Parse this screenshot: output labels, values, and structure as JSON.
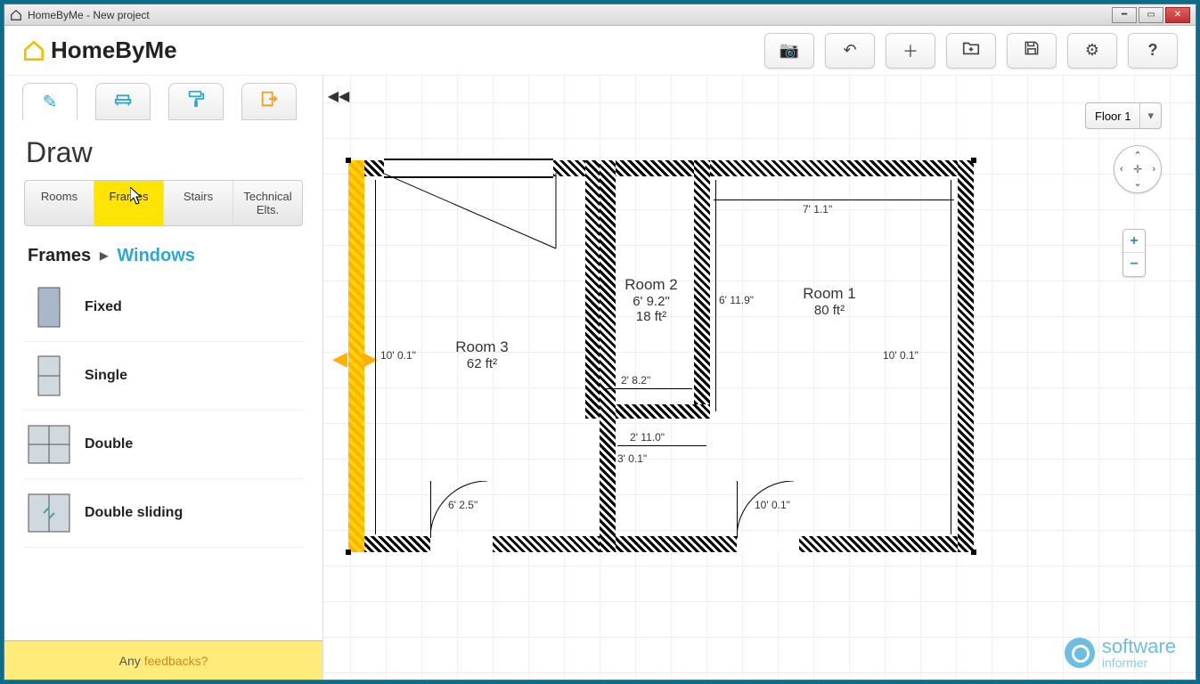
{
  "window": {
    "title": "HomeByMe - New project"
  },
  "brand": {
    "name": "HomeByMe"
  },
  "toolbar": {
    "camera": "camera-icon",
    "undo": "undo-icon",
    "add": "add-icon",
    "import": "import-icon",
    "save": "save-icon",
    "settings": "settings-icon",
    "help": "help-icon"
  },
  "side_tabs": [
    {
      "id": "draw",
      "active": true
    },
    {
      "id": "furnish",
      "active": false
    },
    {
      "id": "decorate",
      "active": false
    },
    {
      "id": "share",
      "active": false
    }
  ],
  "panel": {
    "title": "Draw",
    "sub_tabs": [
      "Rooms",
      "Frames",
      "Stairs",
      "Technical Elts."
    ],
    "active_sub_tab": "Frames",
    "breadcrumb_parent": "Frames",
    "breadcrumb_child": "Windows",
    "items": [
      {
        "label": "Fixed"
      },
      {
        "label": "Single"
      },
      {
        "label": "Double"
      },
      {
        "label": "Double sliding"
      }
    ]
  },
  "feedback": {
    "prefix": "Any",
    "link": "feedbacks?"
  },
  "floor_selector": "Floor 1",
  "plan": {
    "rooms": [
      {
        "name": "Room 1",
        "area": "80 ft²"
      },
      {
        "name": "Room 2",
        "width": "6' 9.2\"",
        "area": "18 ft²"
      },
      {
        "name": "Room 3",
        "area": "62 ft²"
      }
    ],
    "dimensions": {
      "r3_height": "10' 0.1\"",
      "r1_top": "7' 1.1\"",
      "r1_left": "6' 11.9\"",
      "r1_right": "10' 0.1\"",
      "r2_bottom": "2' 8.2\"",
      "hall_w": "2' 11.0\"",
      "hall_h": "3' 0.1\"",
      "door_l": "6' 2.5\"",
      "door_r": "10' 0.1\""
    }
  },
  "watermark": {
    "l1": "software",
    "l2": "informer"
  }
}
